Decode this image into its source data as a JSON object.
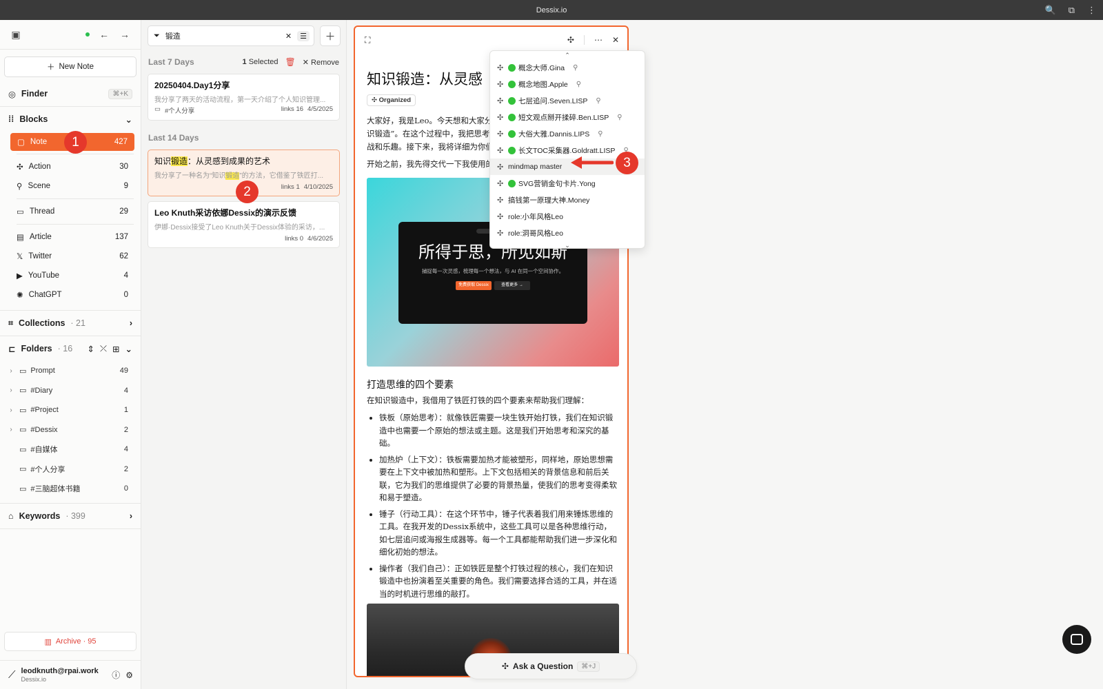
{
  "window": {
    "title": "Dessix.io"
  },
  "sidebar": {
    "new_note": "New Note",
    "finder": {
      "label": "Finder",
      "shortcut": "⌘+K"
    },
    "blocks": {
      "label": "Blocks",
      "items": [
        {
          "label": "Note",
          "count": "427"
        },
        {
          "label": "Action",
          "count": "30"
        },
        {
          "label": "Scene",
          "count": "9"
        },
        {
          "label": "Thread",
          "count": "29"
        },
        {
          "label": "Article",
          "count": "137"
        },
        {
          "label": "Twitter",
          "count": "62"
        },
        {
          "label": "YouTube",
          "count": "4"
        },
        {
          "label": "ChatGPT",
          "count": "0"
        }
      ]
    },
    "collections": {
      "label": "Collections",
      "count": "· 21"
    },
    "folders": {
      "label": "Folders",
      "count": "· 16",
      "items": [
        {
          "label": "Prompt",
          "count": "49"
        },
        {
          "label": "#Diary",
          "count": "4"
        },
        {
          "label": "#Project",
          "count": "1"
        },
        {
          "label": "#Dessix",
          "count": "2"
        },
        {
          "label": "#自媒体",
          "count": "4"
        },
        {
          "label": "#个人分享",
          "count": "2"
        },
        {
          "label": "#三脑超体书籍",
          "count": "0"
        }
      ]
    },
    "keywords": {
      "label": "Keywords",
      "count": "· 399"
    },
    "archive": "Archive · 95",
    "user": {
      "email": "leodknuth@rpai.work",
      "sub": "Dessix.io"
    }
  },
  "list": {
    "search_value": "锻造",
    "groups": {
      "last7": {
        "label": "Last 7 Days",
        "selected_num": "1",
        "selected_text": " Selected",
        "remove": "Remove"
      },
      "last14": {
        "label": "Last 14 Days"
      }
    },
    "cards": [
      {
        "title": "20250404.Day1分享",
        "snippet": "我分享了两天的活动流程，第一天介绍了个人知识管理...",
        "folder": "#个人分享",
        "links": "links 16",
        "date": "4/5/2025"
      },
      {
        "title_pre": "知识",
        "title_mark": "锻造",
        "title_post": "：从灵感到成果的艺术",
        "snippet_pre": "我分享了一种名为“知识",
        "snippet_mark": "锻造",
        "snippet_post": "”的方法，它借鉴了铁匠打...",
        "links": "links 1",
        "date": "4/10/2025"
      },
      {
        "title": "Leo Knuth采访依娜Dessix的演示反馈",
        "snippet": "伊娜·Dessix接受了Leo Knuth关于Dessix体验的采访，...",
        "links": "links 0",
        "date": "4/6/2025"
      }
    ]
  },
  "editor": {
    "title": "知识锻造：从灵感",
    "badge": "Organized",
    "intro": "大家好，我是Leo。今天想和大家分享一下我的思考过程，我称之为“知识锻造”。在这个过程中，我把思考类比于铁匠打铁，这一过程充满了挑战和乐趣。接下来，我将详细为你们介绍这个过程的各个环节。",
    "intro2": "开始之前，我先得交代一下我使用的工具 Dessix（https://dessix.io/）",
    "hero": {
      "big": "所得于思，所见如斯",
      "small": "捕捉每一次灵感，梳理每一个想法，与 AI 在同一个空间协作。",
      "btn1": "免费获取 Dessix",
      "btn2": "查看更多 →",
      "pill": "无需注册即可体验"
    },
    "h2": "打造思维的四个要素",
    "lead": "在知识锻造中，我借用了铁匠打铁的四个要素来帮助我们理解：",
    "bullets": [
      "铁板（原始思考）：就像铁匠需要一块生铁开始打铁，我们在知识锻造中也需要一个原始的想法或主题。这是我们开始思考和深究的基础。",
      "加热炉（上下文）：铁板需要加热才能被塑形，同样地，原始思想需要在上下文中被加热和塑形。上下文包括相关的背景信息和前后关联，它为我们的思维提供了必要的背景热量，使我们的思考变得柔软和易于塑造。",
      "锤子（行动工具）：在这个环节中，锤子代表着我们用来锤炼思维的工具。在我开发的Dessix系统中，这些工具可以是各种思维行动，如七层追问或海报生成器等。每一个工具都能帮助我们进一步深化和细化初始的想法。",
      "操作者（我们自己）：正如铁匠是整个打铁过程的核心，我们在知识锻造中也扮演着至关重要的角色。我们需要选择合适的工具，并在适当的时机进行思维的敲打。"
    ]
  },
  "dropdown": {
    "items": [
      {
        "label": "概念大师.Gina",
        "green": true,
        "pin": true
      },
      {
        "label": "概念地图.Apple",
        "green": true,
        "pin": true
      },
      {
        "label": "七层追问.Seven.LISP",
        "green": true,
        "pin": true
      },
      {
        "label": "短文观点掰开揉碎.Ben.LISP",
        "green": true,
        "pin": true
      },
      {
        "label": "大俗大雅.Dannis.LIPS",
        "green": true,
        "pin": true
      },
      {
        "label": "长文TOC采集器.Goldratt.LISP",
        "green": true,
        "pin": true
      },
      {
        "label": "mindmap master",
        "green": false,
        "pin": false
      },
      {
        "label": "SVG营销金句卡片.Yong",
        "green": true,
        "pin": false
      },
      {
        "label": "搞钱第一原理大神.Money",
        "green": false,
        "pin": false
      },
      {
        "label": "role:小年风格Leo",
        "green": false,
        "pin": false
      },
      {
        "label": "role:洞哥风格Leo",
        "green": false,
        "pin": false
      }
    ]
  },
  "annotations": {
    "a1": "1",
    "a2": "2",
    "a3": "3"
  },
  "ask": {
    "label": "Ask a Question",
    "shortcut": "⌘+J"
  },
  "colors": {
    "accent": "#f2662e",
    "highlight": "#fde94a",
    "annotation": "#e5382b",
    "status_green": "#33c23a"
  }
}
